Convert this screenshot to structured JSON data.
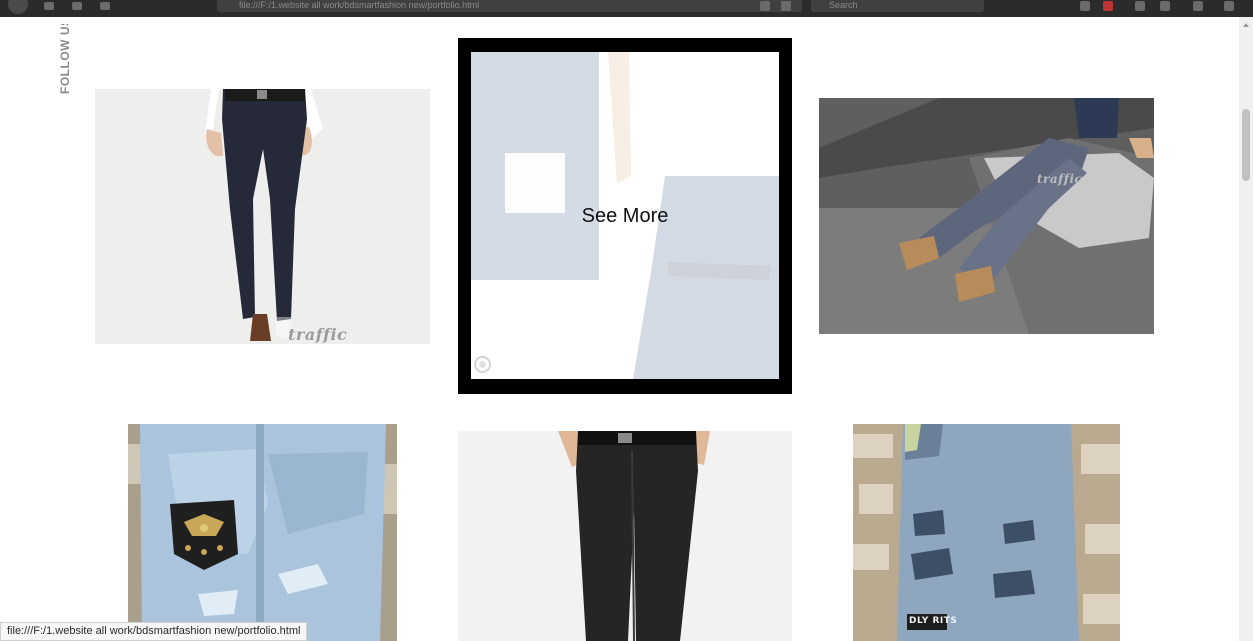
{
  "browser": {
    "url": "file:///F:/1.website all work/bdsmartfashion new/portfolio.html",
    "search_placeholder": "Search"
  },
  "sidebar": {
    "follow_label": "FOLLOW US"
  },
  "portfolio": {
    "hover_label": "See More",
    "watermark": "traffic",
    "patch_text": "DLY RITS",
    "items": [
      {
        "name": "navy-trousers"
      },
      {
        "name": "denim-jeans-hover"
      },
      {
        "name": "grey-trousers-seated"
      },
      {
        "name": "light-ripped-jeans-eagle"
      },
      {
        "name": "black-trousers"
      },
      {
        "name": "grey-ripped-jeans"
      }
    ]
  },
  "statusbar": {
    "text": "file:///F:/1.website all work/bdsmartfashion new/portfolio.html"
  },
  "colors": {
    "frame": "#000000",
    "label_grey": "#8a8a8a",
    "chrome": "#2b2b2b"
  }
}
